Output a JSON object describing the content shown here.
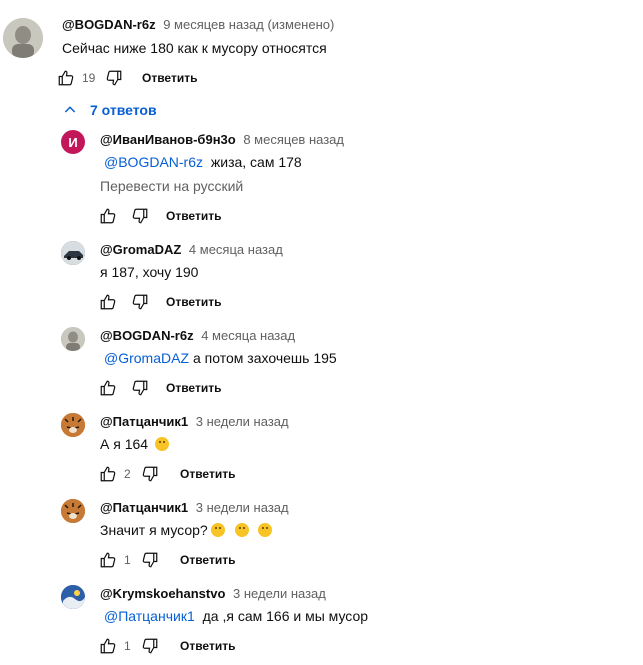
{
  "top_comment": {
    "author": "@BOGDAN-r6z",
    "time": "9 месяцев назад (изменено)",
    "text": "Сейчас ниже 180 как к мусору относятся",
    "likes": "19",
    "reply_label": "Ответить",
    "avatar_color": "#bdbcb4"
  },
  "replies_toggle": {
    "label": "7 ответов",
    "icon": "chevron-up-icon"
  },
  "replies": [
    {
      "author": "@ИванИванов-б9н3о",
      "time": "8 месяцев назад",
      "mention": "@BOGDAN-r6z",
      "text": " жиза, сам 178",
      "translate": "Перевести на русский",
      "likes": "",
      "reply_label": "Ответить",
      "avatar_letter": "И",
      "avatar_color": "#c2185b"
    },
    {
      "author": "@GromaDAZ",
      "time": "4 месяца назад",
      "mention": "",
      "text": "я 187, хочу 190",
      "likes": "",
      "reply_label": "Ответить",
      "avatar_color": "#3c4a55"
    },
    {
      "author": "@BOGDAN-r6z",
      "time": "4 месяца назад",
      "mention": "@GromaDAZ",
      "text": "а потом захочешь 195",
      "likes": "",
      "reply_label": "Ответить",
      "avatar_color": "#bdbcb4"
    },
    {
      "author": "@Патцанчик1",
      "time": "3 недели назад",
      "mention": "",
      "text": "А я 164",
      "emoji_count": 1,
      "likes": "2",
      "reply_label": "Ответить",
      "avatar_color": "#a0602a"
    },
    {
      "author": "@Патцанчик1",
      "time": "3 недели назад",
      "mention": "",
      "text": "Значит я мусор?",
      "emoji_count": 3,
      "likes": "1",
      "reply_label": "Ответить",
      "avatar_color": "#a0602a"
    },
    {
      "author": "@Krymskoehanstvo",
      "time": "3 недели назад",
      "mention": "@Патцанчик1",
      "text": " да ,я сам 166 и мы мусор",
      "likes": "1",
      "reply_label": "Ответить",
      "avatar_color": "#2d5fa8"
    }
  ]
}
